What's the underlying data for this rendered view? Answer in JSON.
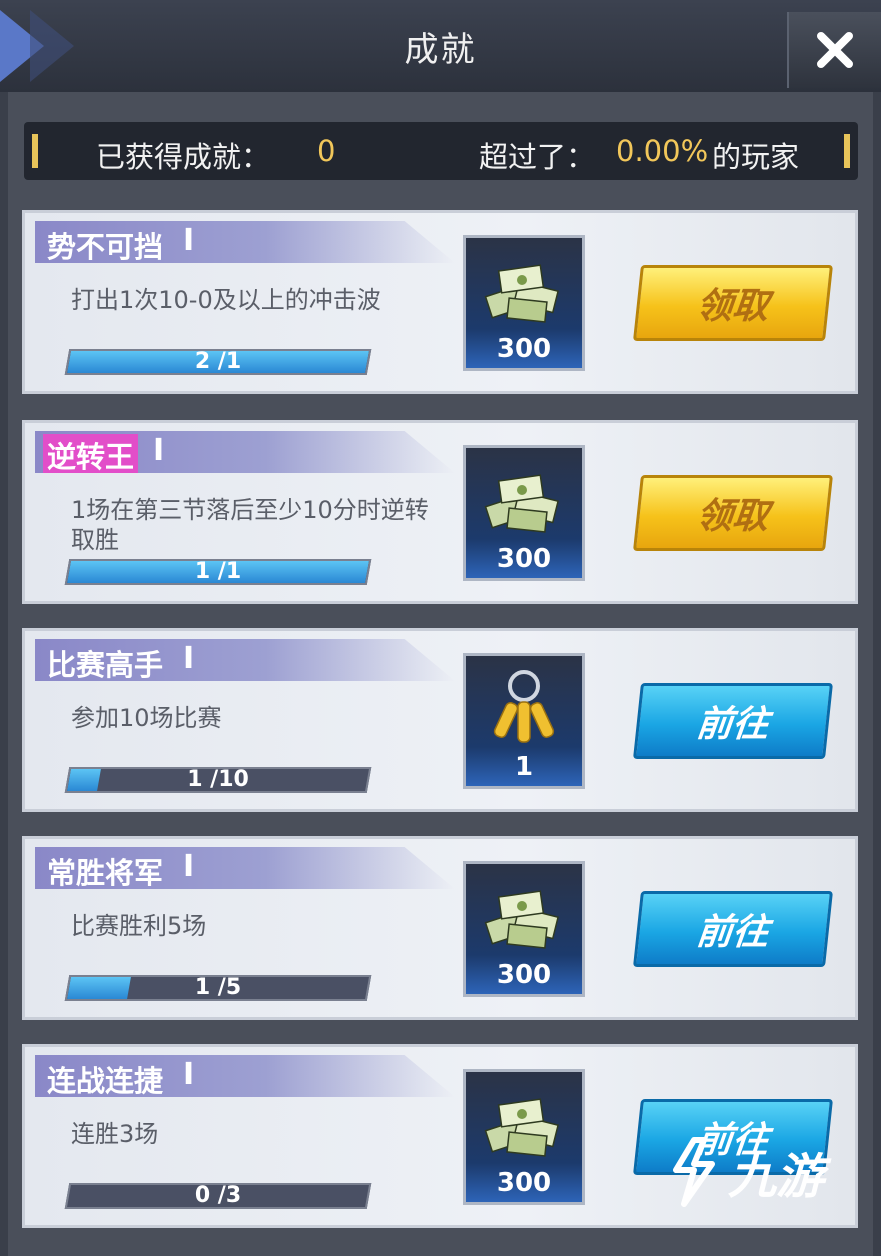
{
  "header": {
    "title": "成就"
  },
  "summary": {
    "achieved_label": "已获得成就：",
    "achieved_value": "0",
    "exceed_label": "超过了：",
    "exceed_value": "0.00%",
    "players_label": "的玩家"
  },
  "achievements": [
    {
      "name": "势不可挡",
      "tier": "I",
      "desc": "打出1次10-0及以上的冲击波",
      "progress": "2 /1",
      "progress_fraction": 1.0,
      "reward_icon": "cash-stack-icon",
      "reward_amount": "300",
      "button": "领取",
      "button_style": "gold",
      "highlight": false
    },
    {
      "name": "逆转王",
      "tier": "I",
      "desc": "1场在第三节落后至少10分时逆转取胜",
      "progress": "1 /1",
      "progress_fraction": 1.0,
      "reward_icon": "cash-stack-icon",
      "reward_amount": "300",
      "button": "领取",
      "button_style": "gold",
      "highlight": true
    },
    {
      "name": "比赛高手",
      "tier": "I",
      "desc": "参加10场比赛",
      "progress": "1 /10",
      "progress_fraction": 0.1,
      "reward_icon": "keys-icon",
      "reward_amount": "1",
      "button": "前往",
      "button_style": "blue",
      "highlight": false
    },
    {
      "name": "常胜将军",
      "tier": "I",
      "desc": "比赛胜利5场",
      "progress": "1 /5",
      "progress_fraction": 0.2,
      "reward_icon": "cash-stack-icon",
      "reward_amount": "300",
      "button": "前往",
      "button_style": "blue",
      "highlight": false
    },
    {
      "name": "连战连捷",
      "tier": "I",
      "desc": "连胜3场",
      "progress": "0 /3",
      "progress_fraction": 0.0,
      "reward_icon": "cash-stack-icon",
      "reward_amount": "300",
      "button": "前往",
      "button_style": "blue",
      "highlight": false
    }
  ],
  "watermark": {
    "text": "九游"
  },
  "colors": {
    "gold": "#f6c21a",
    "blue": "#1aa6e4",
    "accent_value": "#f2c75a",
    "highlight_pink": "#e24ec9"
  }
}
